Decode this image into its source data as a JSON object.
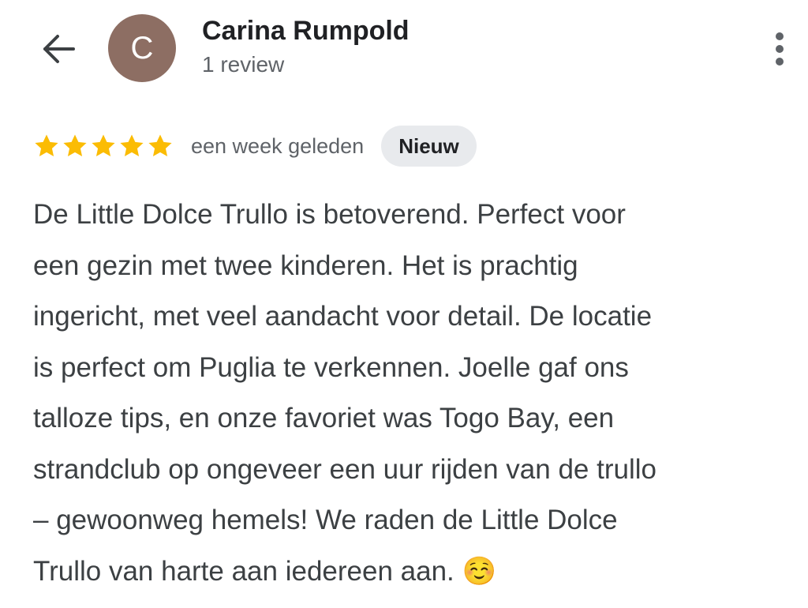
{
  "header": {
    "back_icon": "arrow-left-icon",
    "avatar_letter": "C",
    "avatar_color": "#8d6e63",
    "reviewer_name": "Carina Rumpold",
    "review_count": "1 review",
    "more_icon": "more-vertical-icon"
  },
  "review": {
    "rating": 5,
    "rating_max": 5,
    "star_color": "#fbbc04",
    "date": "een week geleden",
    "badge": "Nieuw",
    "lines": [
      "De Little Dolce Trullo is betoverend. Perfect voor",
      "een gezin met twee kinderen. Het is prachtig",
      "ingericht, met veel aandacht voor detail. De locatie",
      "is perfect om Puglia te verkennen. Joelle gaf ons",
      "talloze tips, en onze favoriet was Togo Bay, een",
      "strandclub op ongeveer een uur rijden van de trullo",
      "– gewoonweg hemels! We raden de Little Dolce",
      "Trullo van harte aan iedereen aan. ☺️"
    ]
  }
}
